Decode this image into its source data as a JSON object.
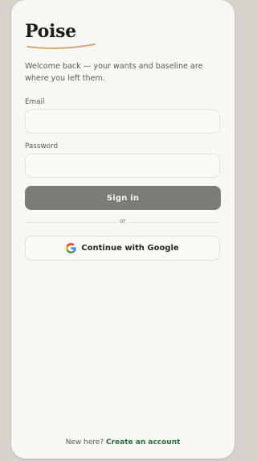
{
  "brand": {
    "name": "Poise",
    "accent": "#d3aa6a"
  },
  "welcome_text": "Welcome back — your wants and baseline are where you left them.",
  "form": {
    "email_label": "Email",
    "email_value": "",
    "password_label": "Password",
    "password_value": "",
    "submit_label": "Sign in",
    "divider_text": "or",
    "google_label": "Continue with Google"
  },
  "footer": {
    "prompt": "New here?",
    "link_label": "Create an account",
    "link_color": "#2f6a45"
  },
  "icons": {
    "google": "google-g-icon"
  },
  "colors": {
    "background": "#d6d3cc",
    "card": "#f8f7f3",
    "button": "#7d7b76"
  }
}
